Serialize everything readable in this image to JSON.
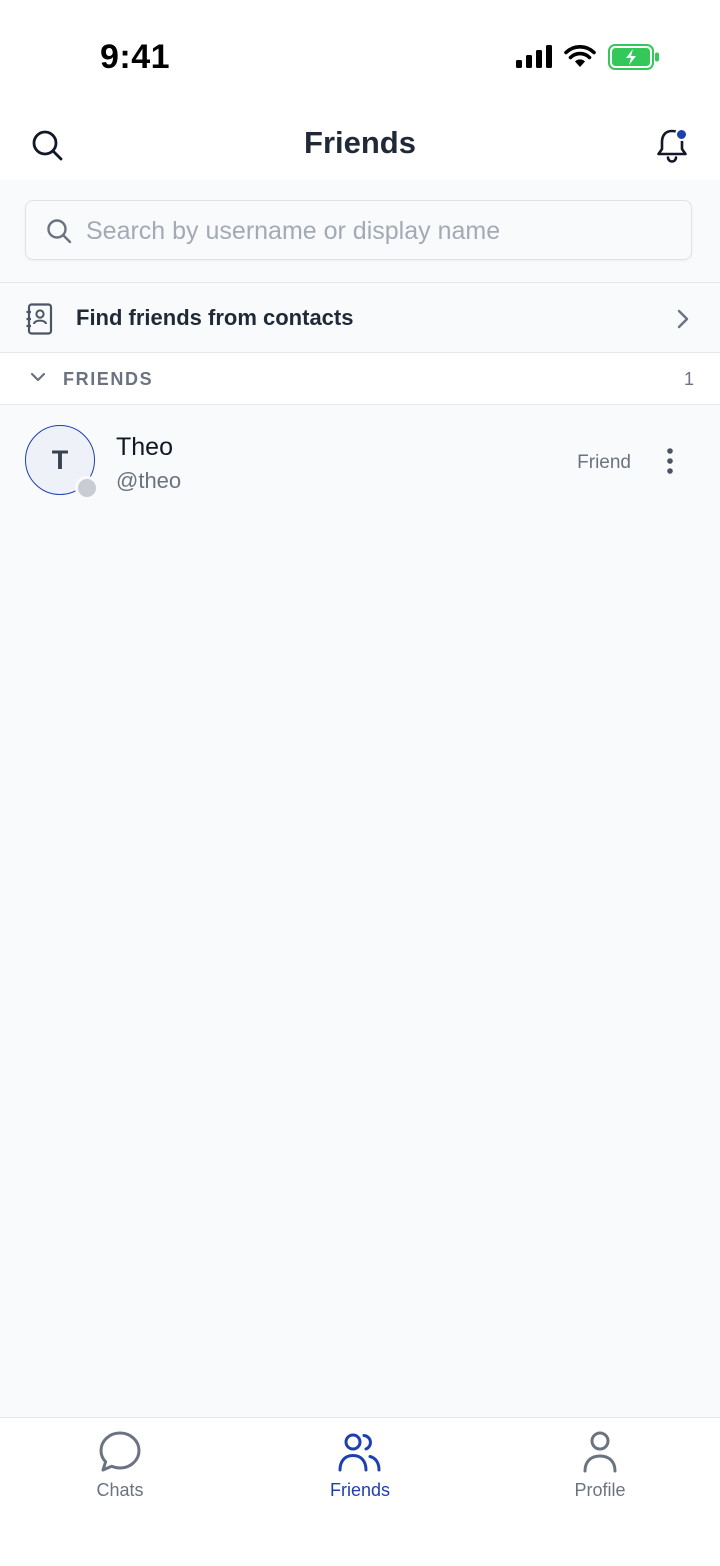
{
  "status_bar": {
    "time": "9:41"
  },
  "app_bar": {
    "title": "Friends"
  },
  "search": {
    "placeholder": "Search by username or display name",
    "value": ""
  },
  "find_contacts": {
    "label": "Find friends from contacts"
  },
  "section": {
    "title": "FRIENDS",
    "count": "1"
  },
  "friends": [
    {
      "initial": "T",
      "name": "Theo",
      "handle": "@theo",
      "status": "Friend"
    }
  ],
  "tabs": [
    {
      "label": "Chats",
      "icon": "chat-bubble-icon",
      "active": false
    },
    {
      "label": "Friends",
      "icon": "friends-icon",
      "active": true
    },
    {
      "label": "Profile",
      "icon": "profile-icon",
      "active": false
    }
  ],
  "colors": {
    "accent": "#1e40af",
    "text_primary": "#111827",
    "text_secondary": "#6b7280",
    "background": "#f9fafb",
    "battery_green": "#34c759"
  }
}
